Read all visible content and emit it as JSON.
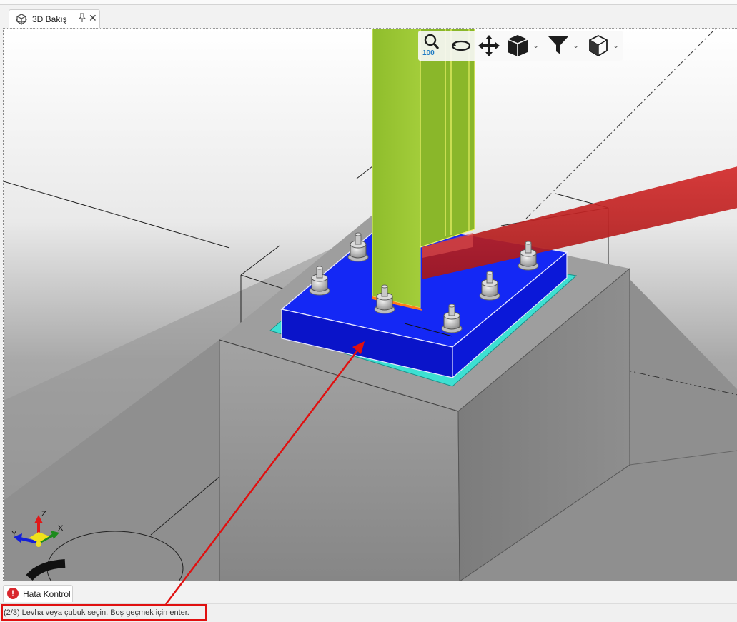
{
  "tab": {
    "title": "3D Bakış"
  },
  "toolbar": {
    "zoom_value": "100"
  },
  "bottom_panel": {
    "tab_label": "Hata Kontrol"
  },
  "status": {
    "message": "(2/3) Levha veya çubuk seçin. Boş geçmek için enter."
  },
  "axes": {
    "z": "Z",
    "y": "Y",
    "x": "X"
  },
  "colors": {
    "column": "#9bc436",
    "base_plate": "#0a1bf0",
    "grout": "#3de0d2",
    "beam": "#c62020",
    "concrete": "#8c8c8c",
    "highlight": "#e01010",
    "error_icon": "#d9262c"
  },
  "icons": [
    "view-3d-icon",
    "pin-icon",
    "close-icon",
    "zoom-icon",
    "rotate-icon",
    "pan-icon",
    "view-cube-icon",
    "filter-icon",
    "render-mode-icon",
    "chevron-down-icon",
    "error-icon"
  ]
}
